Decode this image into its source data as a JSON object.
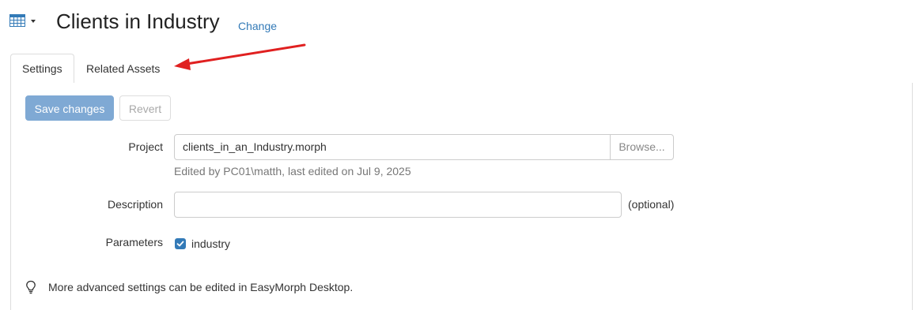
{
  "header": {
    "title": "Clients in Industry",
    "change_link": "Change",
    "type_icon": "table-grid-icon"
  },
  "tabs": [
    {
      "label": "Settings",
      "active": true
    },
    {
      "label": "Related Assets",
      "active": false
    }
  ],
  "toolbar": {
    "save_label": "Save changes",
    "revert_label": "Revert"
  },
  "form": {
    "project": {
      "label": "Project",
      "value": "clients_in_an_Industry.morph",
      "browse_label": "Browse...",
      "help": "Edited by PC01\\matth, last edited on Jul 9, 2025"
    },
    "description": {
      "label": "Description",
      "value": "",
      "optional": "(optional)"
    },
    "parameters": {
      "label": "Parameters",
      "items": [
        {
          "label": "industry",
          "checked": true
        }
      ]
    }
  },
  "tip": {
    "icon": "lightbulb-icon",
    "text": "More advanced settings can be edited in EasyMorph Desktop."
  },
  "colors": {
    "accent": "#337ab7",
    "save_button": "#7fa9d4",
    "annotation_arrow": "#e02020"
  }
}
